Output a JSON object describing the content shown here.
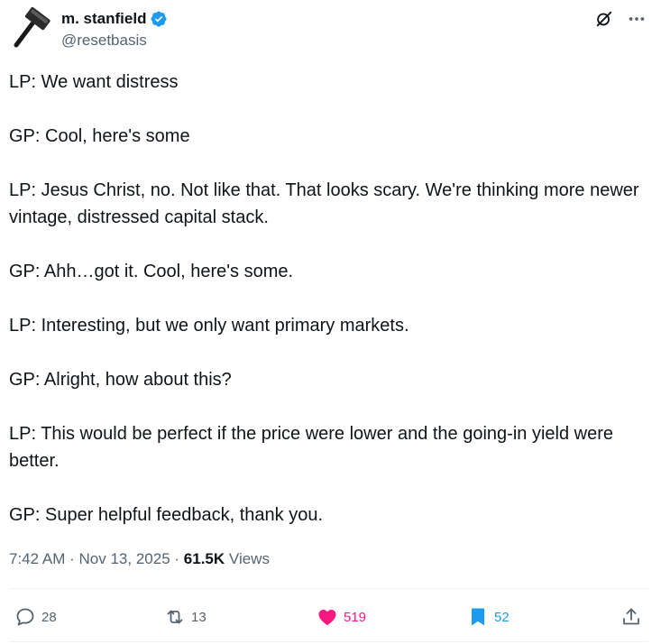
{
  "author": {
    "display_name": "m. stanfield",
    "handle": "@resetbasis",
    "verified": true,
    "avatar_icon": "sledgehammer-icon"
  },
  "tweet": {
    "paragraphs": [
      "LP: We want distress",
      "GP: Cool, here's some",
      "LP: Jesus Christ, no. Not like that. That looks scary. We're thinking more newer vintage, distressed capital stack.",
      "GP: Ahh…got it. Cool, here's some.",
      "LP: Interesting, but we only want primary markets.",
      "GP: Alright, how about this?",
      "LP: This would be perfect if the price were lower and the going-in yield were better.",
      "GP: Super helpful feedback, thank you."
    ],
    "time": "7:42 AM",
    "date": "Nov 13, 2025",
    "separator": "·",
    "views_count": "61.5K",
    "views_label": "Views"
  },
  "actions": {
    "replies": "28",
    "reposts": "13",
    "likes": "519",
    "bookmarks": "52"
  },
  "colors": {
    "verified": "#1d9bf0",
    "like": "#f91880",
    "bookmark": "#1d9bf0",
    "muted": "#536471",
    "text": "#0f1419"
  }
}
